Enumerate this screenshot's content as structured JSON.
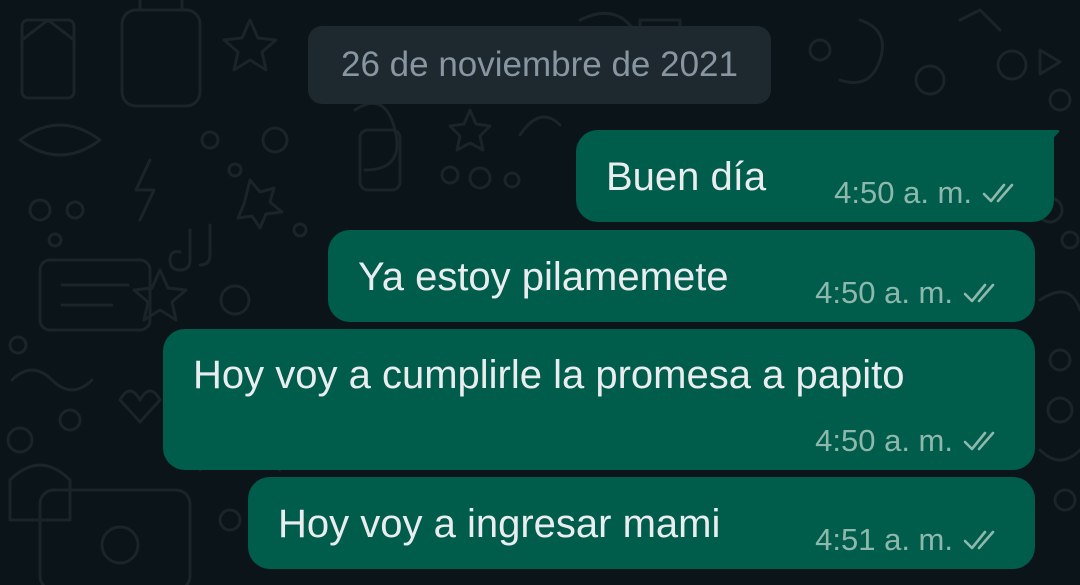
{
  "chat": {
    "date_separator": "26 de noviembre de 2021",
    "messages": [
      {
        "text": "Buen día",
        "time": "4:50 a. m.",
        "status": "read"
      },
      {
        "text": "Ya estoy pilamemete",
        "time": "4:50 a. m.",
        "status": "read"
      },
      {
        "text": "Hoy voy a cumplirle la promesa a papito",
        "time": "4:50 a. m.",
        "status": "read"
      },
      {
        "text": "Hoy voy a ingresar mami",
        "time": "4:51 a. m.",
        "status": "read"
      }
    ]
  },
  "colors": {
    "background": "#0b1418",
    "outgoing_bubble": "#005c4b",
    "date_chip": "#1d282f",
    "message_text": "#e9edef",
    "meta_text": "#8fb8ad"
  },
  "icons": {
    "status_read": "double-check-icon"
  }
}
